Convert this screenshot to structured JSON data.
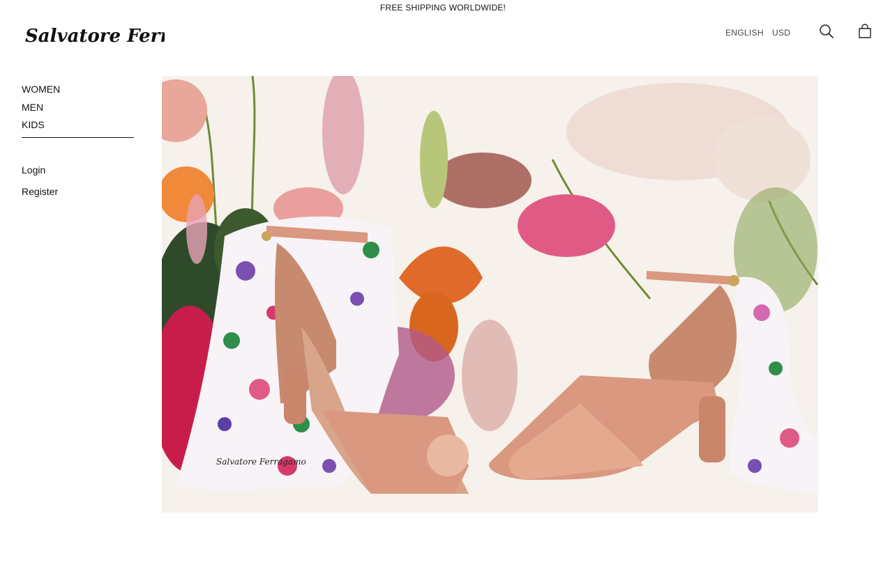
{
  "promo": {
    "text": "FREE SHIPPING WORLDWIDE!"
  },
  "header": {
    "logo_text": "Salvatore Ferragamo",
    "language": "ENGLISH",
    "currency": "USD",
    "icons": {
      "search": "search-icon",
      "cart": "shopping-bag-icon"
    }
  },
  "nav": {
    "items": [
      {
        "label": "WOMEN"
      },
      {
        "label": "MEN"
      },
      {
        "label": "KIDS"
      }
    ]
  },
  "account": {
    "login_label": "Login",
    "register_label": "Register"
  },
  "hero": {
    "scarf_signature": "Salvatore Ferragamo",
    "colors": {
      "background": "#f6f1ea",
      "sandal": "#d9987f",
      "accent_pink": "#e05a86"
    }
  }
}
